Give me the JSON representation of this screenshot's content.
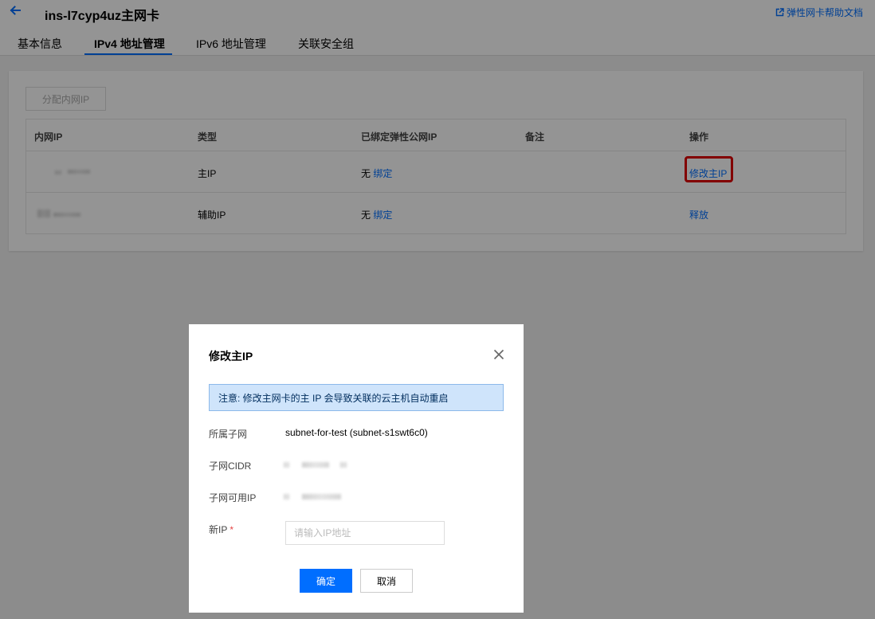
{
  "header": {
    "title": "ins-l7cyp4uz主网卡",
    "back_icon": "arrow-left-icon",
    "help_link": "弹性网卡帮助文档",
    "help_icon": "external-link-icon"
  },
  "tabs": [
    {
      "label": "基本信息",
      "active": false
    },
    {
      "label": "IPv4 地址管理",
      "active": true
    },
    {
      "label": "IPv6 地址管理",
      "active": false
    },
    {
      "label": "关联安全组",
      "active": false
    }
  ],
  "toolbar": {
    "allocate_label": "分配内网IP"
  },
  "table": {
    "columns": [
      "内网IP",
      "类型",
      "已绑定弹性公网IP",
      "备注",
      "操作"
    ],
    "rows": [
      {
        "type": "主IP",
        "eip": "无",
        "eip_action": "绑定",
        "note": "",
        "action": "修改主IP"
      },
      {
        "type": "辅助IP",
        "eip": "无",
        "eip_action": "绑定",
        "note": "",
        "action": "释放"
      }
    ]
  },
  "dialog": {
    "title": "修改主IP",
    "close_icon": "close-icon",
    "notice": "注意: 修改主网卡的主 IP 会导致关联的云主机自动重启",
    "fields": {
      "subnet_label": "所属子网",
      "subnet_value": "subnet-for-test (subnet-s1swt6c0)",
      "cidr_label": "子网CIDR",
      "available_label": "子网可用IP",
      "new_ip_label": "新IP",
      "new_ip_required": "*",
      "new_ip_placeholder": "请输入IP地址",
      "new_ip_value": ""
    },
    "ok_label": "确定",
    "cancel_label": "取消"
  },
  "colors": {
    "accent": "#006eff",
    "highlight": "#e10000",
    "notice_bg": "#cfe4fb"
  }
}
